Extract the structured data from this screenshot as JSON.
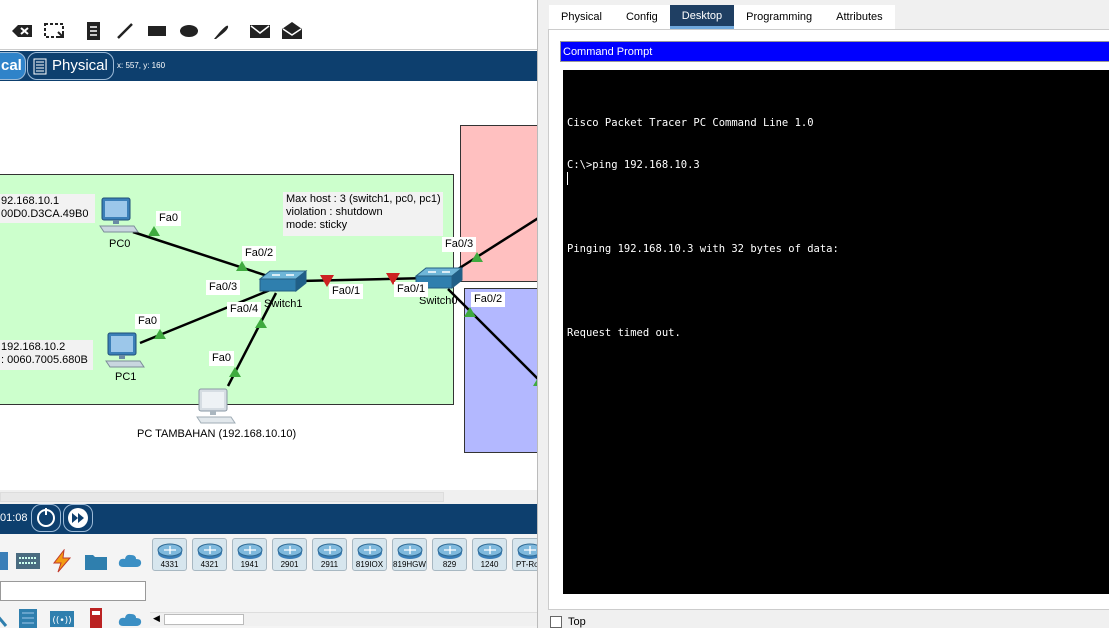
{
  "workspace": {
    "view_tabs": {
      "logical": "cal",
      "physical": "Physical"
    },
    "coords": "x: 557, y: 160",
    "time": "01:08"
  },
  "toolbar": {
    "icons": [
      "delete-icon",
      "resize-icon",
      "note-icon",
      "line-icon",
      "rectangle-icon",
      "ellipse-icon",
      "freeform-icon",
      "envelope-icon",
      "open-envelope-icon"
    ]
  },
  "topology": {
    "pc0_info": [
      "92.168.10.1",
      " 00D0.D3CA.49B0"
    ],
    "pc1_info": [
      "192.168.10.2",
      ": 0060.7005.680B"
    ],
    "port_security_note": [
      "Max host : 3 (switch1, pc0, pc1)",
      "violation : shutdown",
      "mode: sticky"
    ],
    "devices": {
      "pc0": "PC0",
      "pc1": "PC1",
      "pc_tambahan": "PC TAMBAHAN (192.168.10.10)",
      "switch1": "Switch1",
      "switch0": "Switch0"
    },
    "ports": {
      "pc0_fa0": "Fa0",
      "sw1_fa02": "Fa0/2",
      "sw1_fa03": "Fa0/3",
      "sw1_fa04": "Fa0/4",
      "pc1_fa0": "Fa0",
      "pct_fa0": "Fa0",
      "sw1_fa01": "Fa0/1",
      "sw0_fa01": "Fa0/1",
      "sw0_fa03": "Fa0/3",
      "sw0_fa02": "Fa0/2"
    },
    "colors": {
      "green_zone": "#ccffcc",
      "red_zone": "#ffc0c0",
      "blue_zone": "#b3b8ff",
      "link_up": "#3faa3f",
      "link_down": "#cc2222"
    }
  },
  "device_models": [
    "4331",
    "4321",
    "1941",
    "2901",
    "2911",
    "819IOX",
    "819HGW",
    "829",
    "1240",
    "PT-Rou"
  ],
  "dialog": {
    "tabs": [
      "Physical",
      "Config",
      "Desktop",
      "Programming",
      "Attributes"
    ],
    "active_tab": "Desktop",
    "cmd_title": "Command Prompt",
    "terminal_lines": [
      "Cisco Packet Tracer PC Command Line 1.0",
      "C:\\>ping 192.168.10.3",
      "",
      "Pinging 192.168.10.3 with 32 bytes of data:",
      "",
      "Request timed out."
    ],
    "top_label": "Top"
  }
}
